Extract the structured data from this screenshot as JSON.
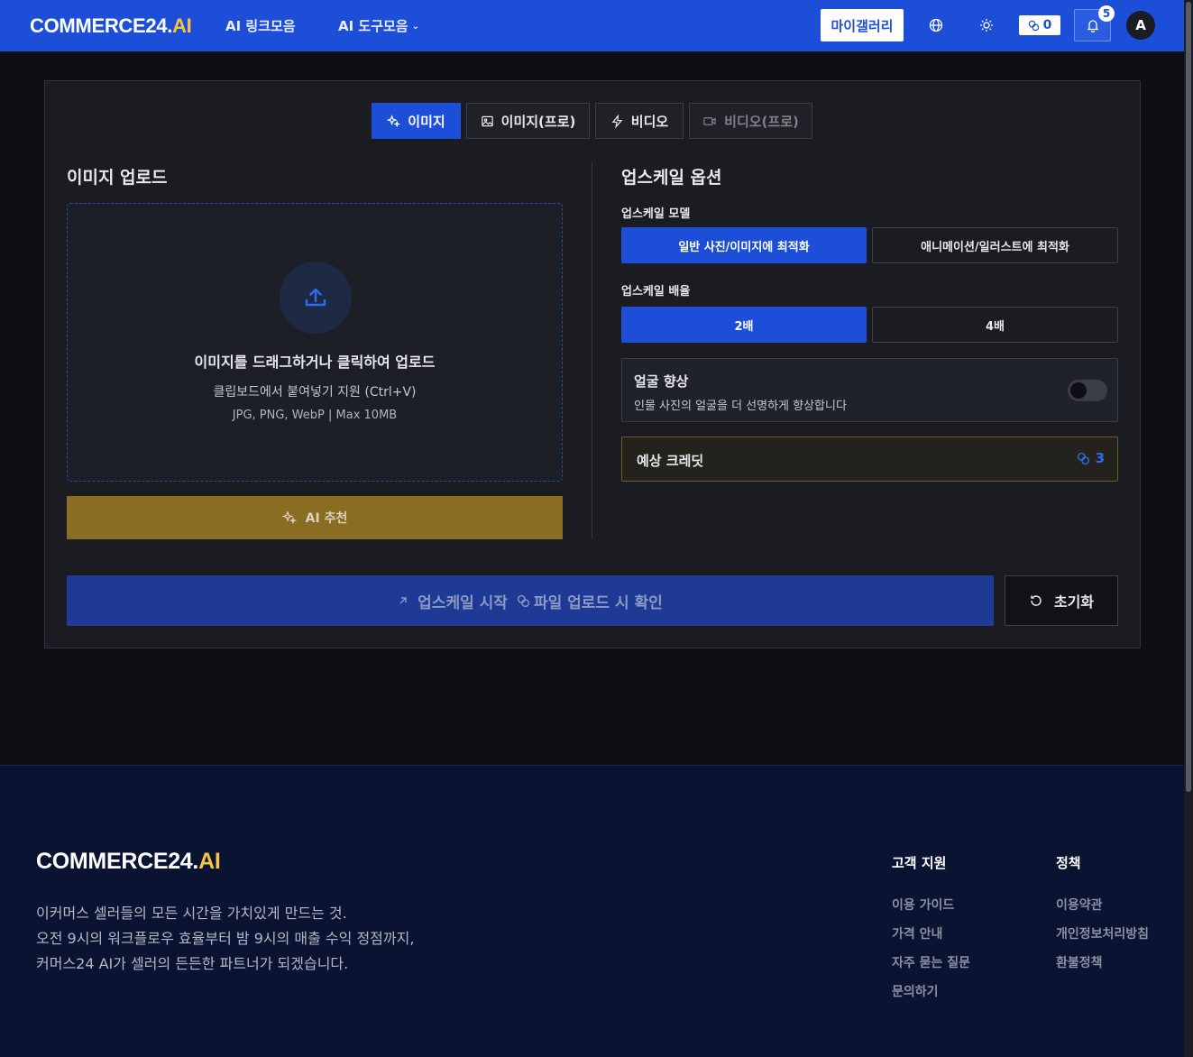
{
  "header": {
    "logo_main": "COMMERCE24.",
    "logo_ai": "AI",
    "nav": [
      "AI 링크모음",
      "AI 도구모음"
    ],
    "nav_dropdown_icon": "chevron-down-icon",
    "gallery_button": "마이갤러리",
    "credits": "0",
    "notification_count": "5",
    "avatar_initial": "A"
  },
  "tabs": [
    {
      "label": "이미지",
      "icon": "sparkles-icon",
      "active": true
    },
    {
      "label": "이미지(프로)",
      "icon": "image-icon",
      "active": false
    },
    {
      "label": "비디오",
      "icon": "lightning-icon",
      "active": false
    },
    {
      "label": "비디오(프로)",
      "icon": "video-camera-icon",
      "active": false,
      "disabled": true
    }
  ],
  "upload": {
    "title": "이미지 업로드",
    "drop_title": "이미지를 드래그하거나 클릭하여 업로드",
    "drop_sub": "클립보드에서 붙여넣기 지원 (Ctrl+V)",
    "drop_meta": "JPG, PNG, WebP | Max 10MB",
    "ai_button": "AI 추천"
  },
  "options": {
    "title": "업스케일 옵션",
    "model_label": "업스케일 모델",
    "models": [
      "일반 사진/이미지에 최적화",
      "애니메이션/일러스트에 최적화"
    ],
    "selected_model": 0,
    "scale_label": "업스케일 배율",
    "scales": [
      "2배",
      "4배"
    ],
    "selected_scale": 0,
    "face_title": "얼굴 향상",
    "face_desc": "인물 사진의 얼굴을 더 선명하게 향상합니다",
    "face_enabled": false,
    "credit_label": "예상 크레딧",
    "credit_value": "3"
  },
  "actions": {
    "start": "업스케일 시작",
    "start_hint": "파일 업로드 시 확인",
    "reset": "초기화"
  },
  "footer": {
    "logo_main": "COMMERCE24.",
    "logo_ai": "AI",
    "desc_lines": [
      "이커머스 셀러들의 모든 시간을 가치있게 만드는 것.",
      "오전 9시의 워크플로우 효율부터 밤 9시의 매출 수익 정점까지,",
      "커머스24 AI가 셀러의 든든한 파트너가 되겠습니다."
    ],
    "support_title": "고객 지원",
    "support_links": [
      "이용 가이드",
      "가격 안내",
      "자주 묻는 질문",
      "문의하기"
    ],
    "policy_title": "정책",
    "policy_links": [
      "이용약관",
      "개인정보처리방침",
      "환불정책"
    ]
  },
  "colors": {
    "brand_blue": "#1d4ed8",
    "ai_gold": "#f5c542",
    "ai_button": "#8a6c22"
  }
}
